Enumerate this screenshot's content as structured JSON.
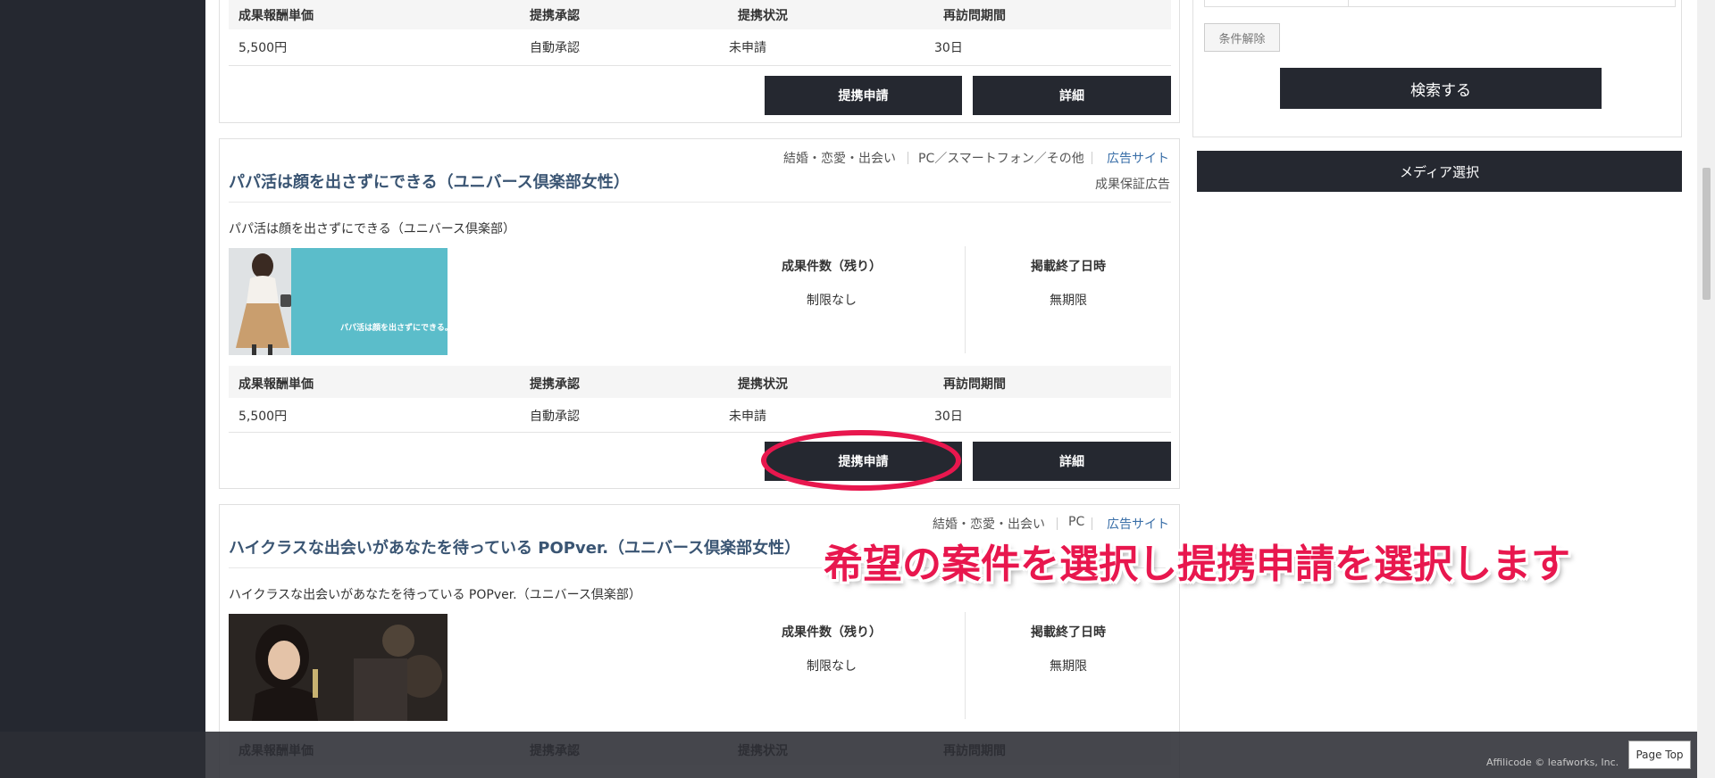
{
  "colors": {
    "accent": "#e8174e",
    "dark": "#252830",
    "title": "#3a5573",
    "link": "#3a6fa8"
  },
  "stats_headers": {
    "price": "成果報酬単価",
    "approval": "提携承認",
    "status": "提携状況",
    "revisit": "再訪問期間"
  },
  "columns": {
    "remaining": "成果件数（残り）",
    "end_date": "掲載終了日時"
  },
  "buttons": {
    "apply": "提携申請",
    "detail": "詳細"
  },
  "card_top": {
    "price": "5,500円",
    "approval": "自動承認",
    "status": "未申請",
    "revisit": "30日"
  },
  "card1": {
    "category": "結婚・恋愛・出会い",
    "devices": "PC／スマートフォン／その他",
    "site_link": "広告サイト",
    "guarantee": "成果保証広告",
    "title": "パパ活は顔を出さずにできる（ユニバース倶楽部女性）",
    "description": "パパ活は顔を出さずにできる（ユニバース倶楽部）",
    "banner_text": "パパ活は顔を出さずにできる。",
    "remaining": "制限なし",
    "end_date": "無期限",
    "price": "5,500円",
    "approval": "自動承認",
    "status": "未申請",
    "revisit": "30日"
  },
  "card2": {
    "category": "結婚・恋愛・出会い",
    "devices": "PC",
    "site_link": "広告サイト",
    "title": "ハイクラスな出会いがあなたを待っている POPver.（ユニバース倶楽部女性）",
    "description": "ハイクラスな出会いがあなたを待っている POPver.（ユニバース倶楽部）",
    "remaining": "制限なし",
    "end_date": "無期限"
  },
  "sidebar": {
    "clear": "条件解除",
    "search": "検索する",
    "media": "メディア選択"
  },
  "footer": {
    "copyright": "Affilicode © leafworks, Inc.",
    "page_top": "Page Top"
  },
  "annotation": {
    "instruction": "希望の案件を選択し提携申請を選択します"
  }
}
